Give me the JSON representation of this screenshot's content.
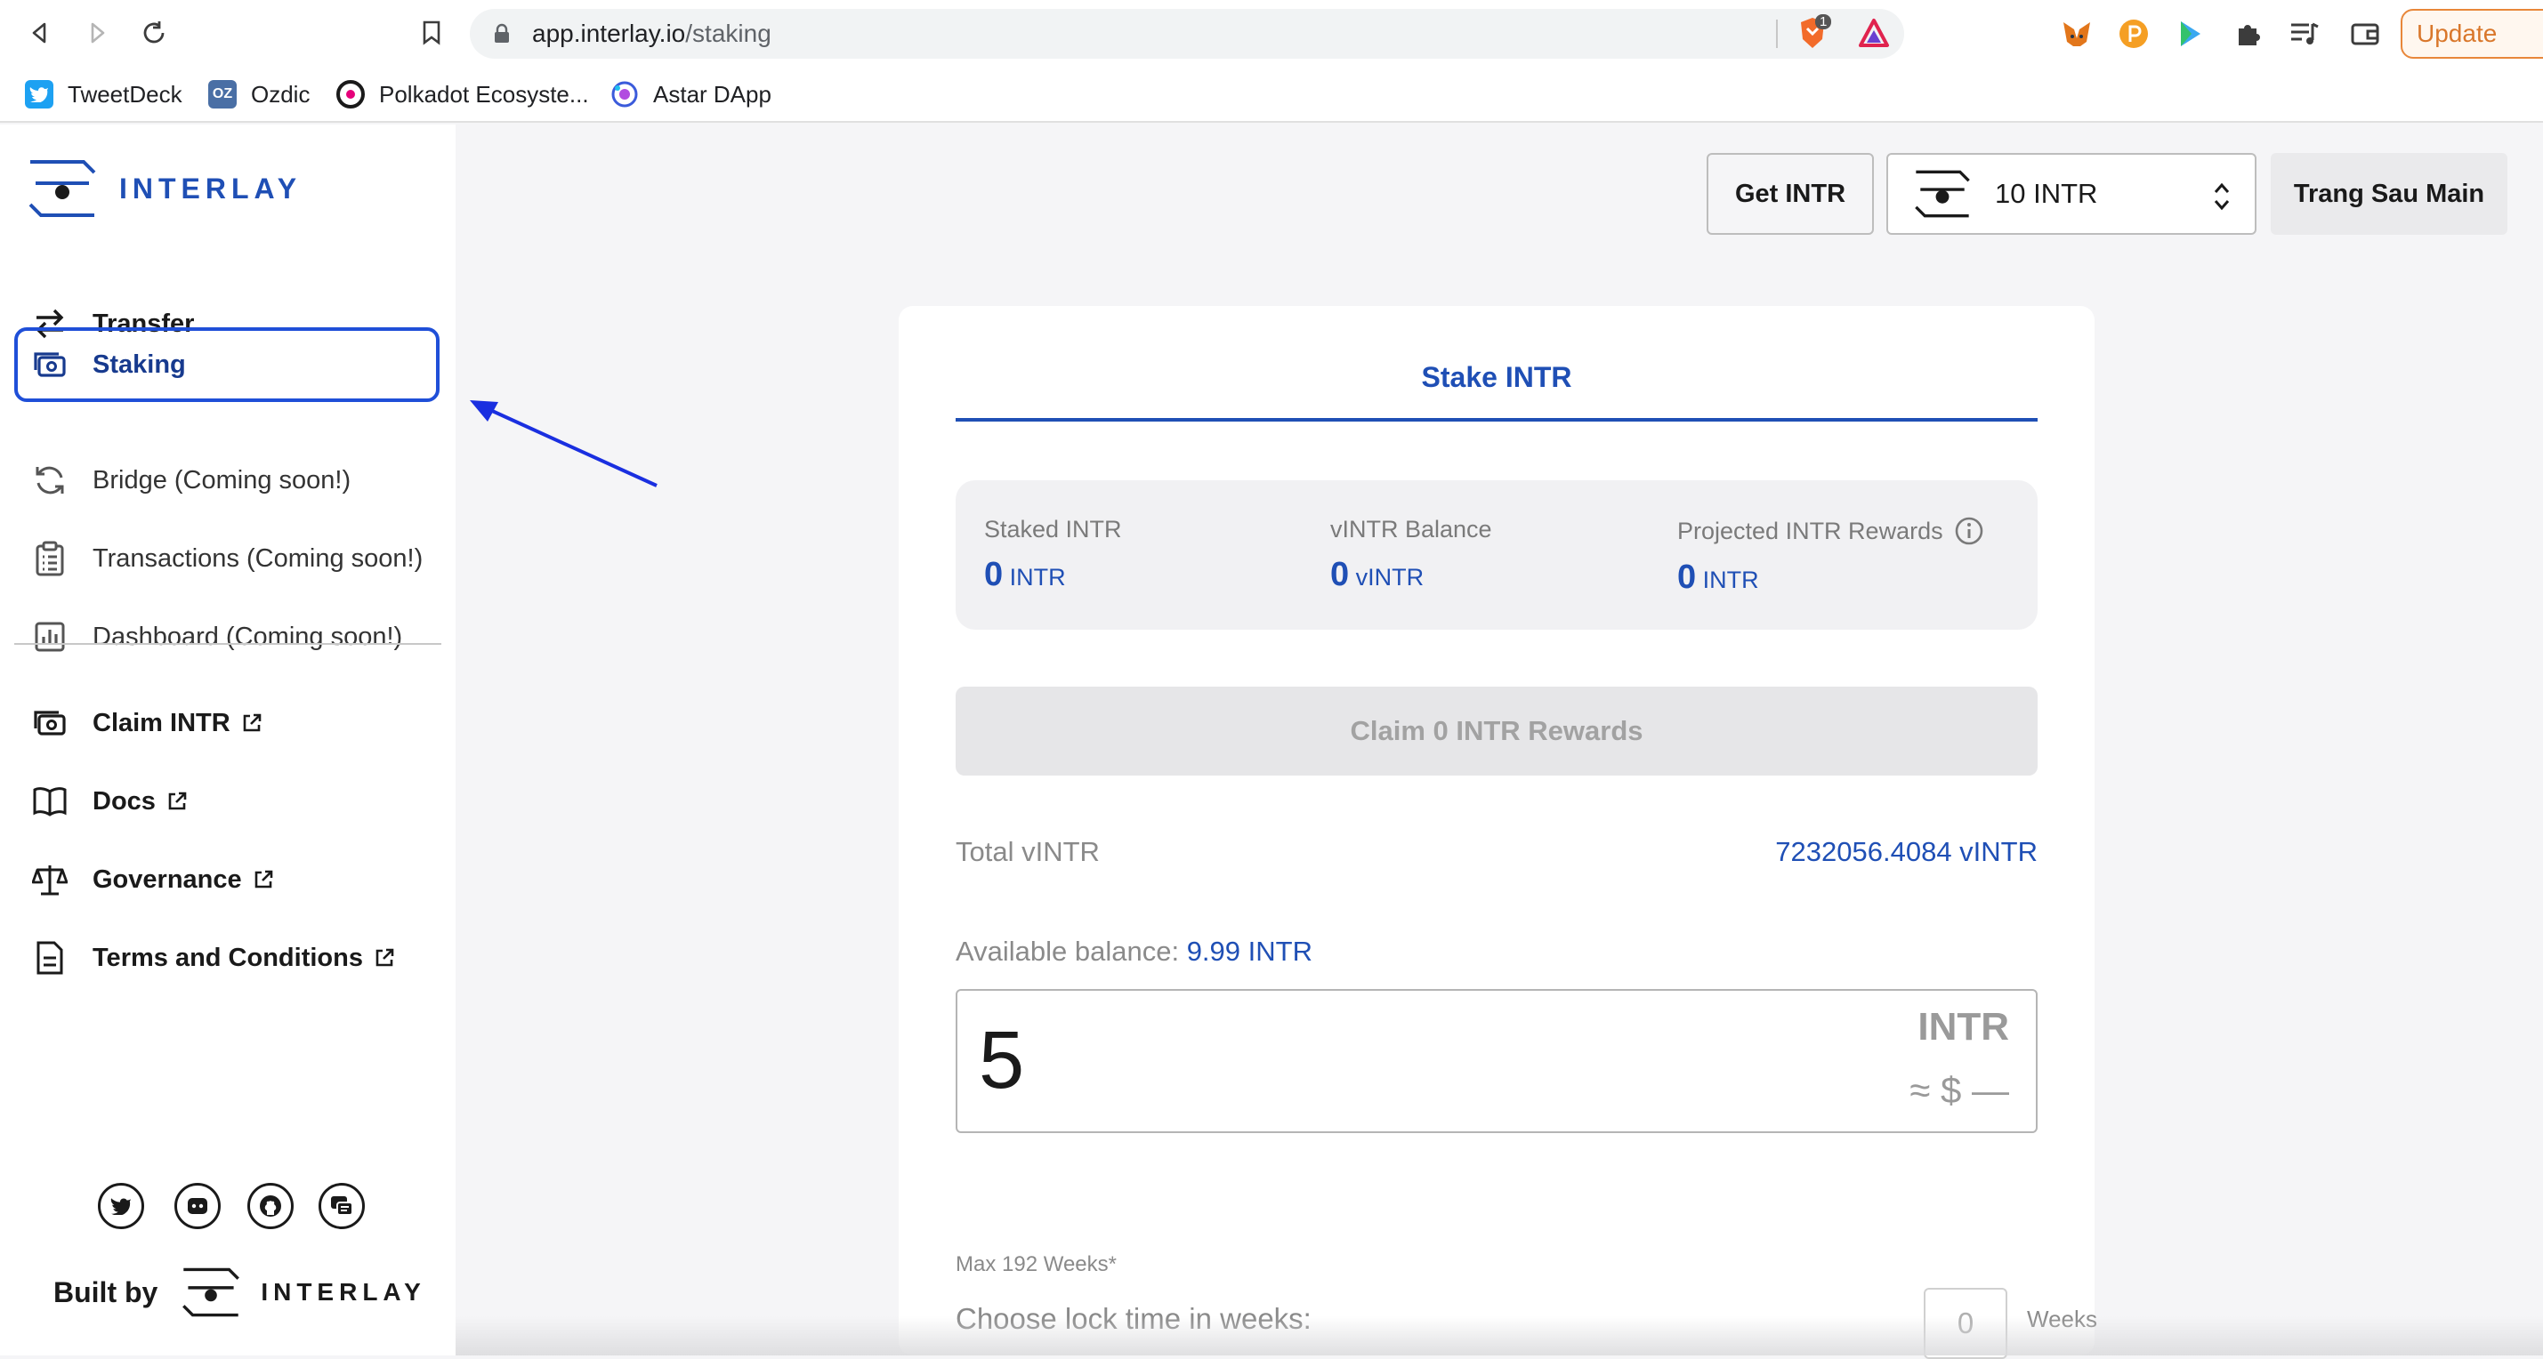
{
  "browser": {
    "url_host": "app.interlay.io",
    "url_path": "/staking",
    "brave_badge": "1",
    "update_label": "Update"
  },
  "bookmarks": [
    {
      "label": "TweetDeck",
      "icon": "twitter-icon",
      "color": "#1da1f2"
    },
    {
      "label": "Ozdic",
      "icon": "ozdic-icon",
      "color": "#4a6fa5",
      "glyph": "OZ"
    },
    {
      "label": "Polkadot Ecosyste...",
      "icon": "polkadot-icon",
      "color": "#1a1a1a"
    },
    {
      "label": "Astar DApp",
      "icon": "astar-icon",
      "color": "#3b5bdb"
    }
  ],
  "sidebar": {
    "logo_text": "INTERLAY",
    "items": [
      {
        "label": "Transfer",
        "icon": "transfer-icon"
      },
      {
        "label": "Staking",
        "icon": "staking-icon",
        "active": true
      },
      {
        "label": "Bridge (Coming soon!)",
        "icon": "bridge-icon"
      },
      {
        "label": "Transactions (Coming soon!)",
        "icon": "transactions-icon"
      },
      {
        "label": "Dashboard (Coming soon!)",
        "icon": "dashboard-icon"
      }
    ],
    "links": [
      {
        "label": "Claim INTR",
        "icon": "claim-icon"
      },
      {
        "label": "Docs",
        "icon": "docs-icon"
      },
      {
        "label": "Governance",
        "icon": "governance-icon"
      },
      {
        "label": "Terms and Conditions",
        "icon": "terms-icon"
      }
    ],
    "built_by": "Built by",
    "built_by_brand": "INTERLAY"
  },
  "header": {
    "get_intr": "Get INTR",
    "balance": "10 INTR",
    "account": "Trang Sau Main"
  },
  "staking": {
    "tab": "Stake INTR",
    "staked_label": "Staked INTR",
    "staked_value": "0",
    "staked_unit": "INTR",
    "vintr_label": "vINTR Balance",
    "vintr_value": "0",
    "vintr_unit": "vINTR",
    "rewards_label": "Projected INTR Rewards",
    "rewards_value": "0",
    "rewards_unit": "INTR",
    "claim_button": "Claim 0 INTR Rewards",
    "total_label": "Total vINTR",
    "total_value": "7232056.4084 vINTR",
    "available_label": "Available balance:",
    "available_value": "9.99 INTR",
    "amount_value": "5",
    "amount_currency": "INTR",
    "amount_usd": "≈ $ —",
    "max_weeks": "Max 192 Weeks*",
    "lock_label": "Choose lock time in weeks:",
    "lock_placeholder": "0",
    "lock_unit": "Weeks"
  },
  "colors": {
    "accent": "#1f4fb5",
    "active_border": "#1f4fd8",
    "arrow": "#1a2fe0"
  }
}
